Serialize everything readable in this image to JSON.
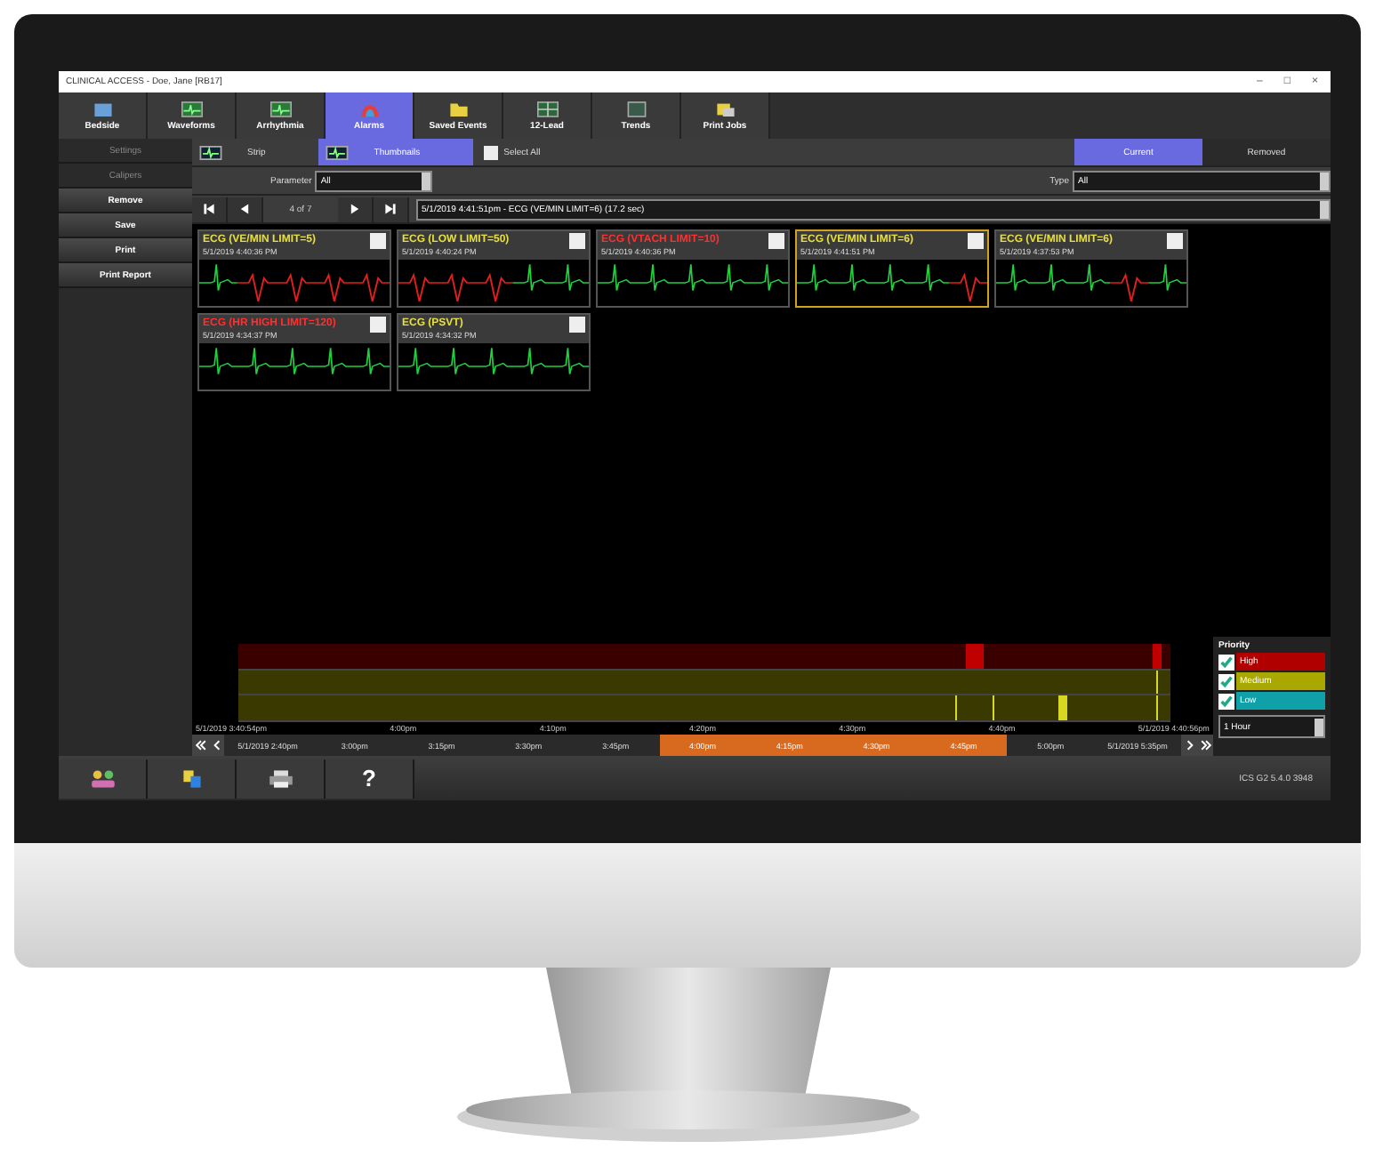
{
  "window": {
    "title": "CLINICAL ACCESS - Doe, Jane [RB17]",
    "controls": [
      "–",
      "□",
      "×"
    ]
  },
  "nav": [
    {
      "label": "Bedside",
      "selected": false
    },
    {
      "label": "Waveforms",
      "selected": false
    },
    {
      "label": "Arrhythmia",
      "selected": false
    },
    {
      "label": "Alarms",
      "selected": true
    },
    {
      "label": "Saved Events",
      "selected": false
    },
    {
      "label": "12-Lead",
      "selected": false
    },
    {
      "label": "Trends",
      "selected": false
    },
    {
      "label": "Print Jobs",
      "selected": false
    }
  ],
  "sidebar": [
    {
      "label": "Settings",
      "disabled": true
    },
    {
      "label": "Calipers",
      "disabled": true
    },
    {
      "label": "Remove",
      "disabled": false
    },
    {
      "label": "Save",
      "disabled": false
    },
    {
      "label": "Print",
      "disabled": false
    },
    {
      "label": "Print Report",
      "disabled": false
    }
  ],
  "view_modes": [
    {
      "label": "Strip",
      "selected": false
    },
    {
      "label": "Thumbnails",
      "selected": true
    }
  ],
  "select_all": {
    "label": "Select All",
    "checked": false
  },
  "list_tabs": [
    {
      "label": "Current",
      "selected": true
    },
    {
      "label": "Removed",
      "selected": false
    }
  ],
  "parameter": {
    "label": "Parameter",
    "value": "All"
  },
  "type": {
    "label": "Type",
    "value": "All"
  },
  "pager": {
    "position": "4 of 7",
    "event": "5/1/2019 4:41:51pm - ECG (VE/MIN LIMIT=6) (17.2 sec)"
  },
  "events": [
    {
      "title": "ECG (VE/MIN LIMIT=5)",
      "time": "5/1/2019 4:40:36 PM",
      "color": "#e8e040",
      "selected": false,
      "checked": false
    },
    {
      "title": "ECG (LOW LIMIT=50)",
      "time": "5/1/2019 4:40:24 PM",
      "color": "#e8e040",
      "selected": false,
      "checked": false
    },
    {
      "title": "ECG (VTACH LIMIT=10)",
      "time": "5/1/2019 4:40:36 PM",
      "color": "#ff3030",
      "selected": false,
      "checked": false
    },
    {
      "title": "ECG (VE/MIN LIMIT=6)",
      "time": "5/1/2019 4:41:51 PM",
      "color": "#e8e040",
      "selected": true,
      "checked": false
    },
    {
      "title": "ECG (VE/MIN LIMIT=6)",
      "time": "5/1/2019 4:37:53 PM",
      "color": "#e8e040",
      "selected": false,
      "checked": false
    },
    {
      "title": "ECG (HR HIGH LIMIT=120)",
      "time": "5/1/2019 4:34:37 PM",
      "color": "#ff3030",
      "selected": false,
      "checked": false
    },
    {
      "title": "ECG (PSVT)",
      "time": "5/1/2019 4:34:32 PM",
      "color": "#e8e040",
      "selected": false,
      "checked": false
    }
  ],
  "timeline": {
    "axis": [
      "5/1/2019 3:40:54pm",
      "4:00pm",
      "4:10pm",
      "4:20pm",
      "4:30pm",
      "4:40pm",
      "5/1/2019 4:40:56pm"
    ],
    "overview": [
      {
        "label": "5/1/2019 2:40pm",
        "in_range": false
      },
      {
        "label": "3:00pm",
        "in_range": false
      },
      {
        "label": "3:15pm",
        "in_range": false
      },
      {
        "label": "3:30pm",
        "in_range": false
      },
      {
        "label": "3:45pm",
        "in_range": false
      },
      {
        "label": "4:00pm",
        "in_range": true
      },
      {
        "label": "4:15pm",
        "in_range": true
      },
      {
        "label": "4:30pm",
        "in_range": true
      },
      {
        "label": "4:45pm",
        "in_range": true
      },
      {
        "label": "5:00pm",
        "in_range": false
      },
      {
        "label": "5/1/2019 5:35pm",
        "in_range": false
      }
    ]
  },
  "priority": {
    "title": "Priority",
    "items": [
      {
        "label": "High",
        "color": "#b00000",
        "checked": true
      },
      {
        "label": "Medium",
        "color": "#a8a800",
        "checked": true
      },
      {
        "label": "Low",
        "color": "#10a0a8",
        "checked": true
      }
    ],
    "range": "1 Hour"
  },
  "bottom": {
    "help": "?",
    "version": "ICS G2 5.4.0 3948"
  }
}
